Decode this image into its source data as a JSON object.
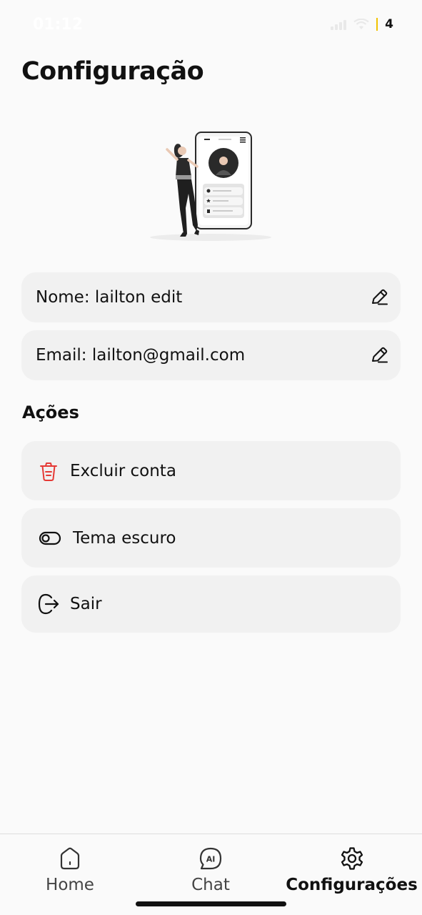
{
  "status_bar": {
    "time": "01:12",
    "battery": "4"
  },
  "page": {
    "title": "Configuração"
  },
  "profile": {
    "name_label": "Nome: lailton edit",
    "email_label": "Email: lailton@gmail.com"
  },
  "actions": {
    "section_title": "Ações",
    "delete_label": "Excluir conta",
    "theme_label": "Tema escuro",
    "logout_label": "Sair"
  },
  "nav": {
    "items": [
      {
        "label": "Home",
        "icon": "home-icon",
        "active": false
      },
      {
        "label": "Chat",
        "icon": "ai-chat-icon",
        "active": false
      },
      {
        "label": "Configurações",
        "icon": "gear-icon",
        "active": true
      }
    ]
  },
  "colors": {
    "danger": "#e53935",
    "background": "#fafafa",
    "card": "#f1f1f1",
    "text": "#111111"
  }
}
